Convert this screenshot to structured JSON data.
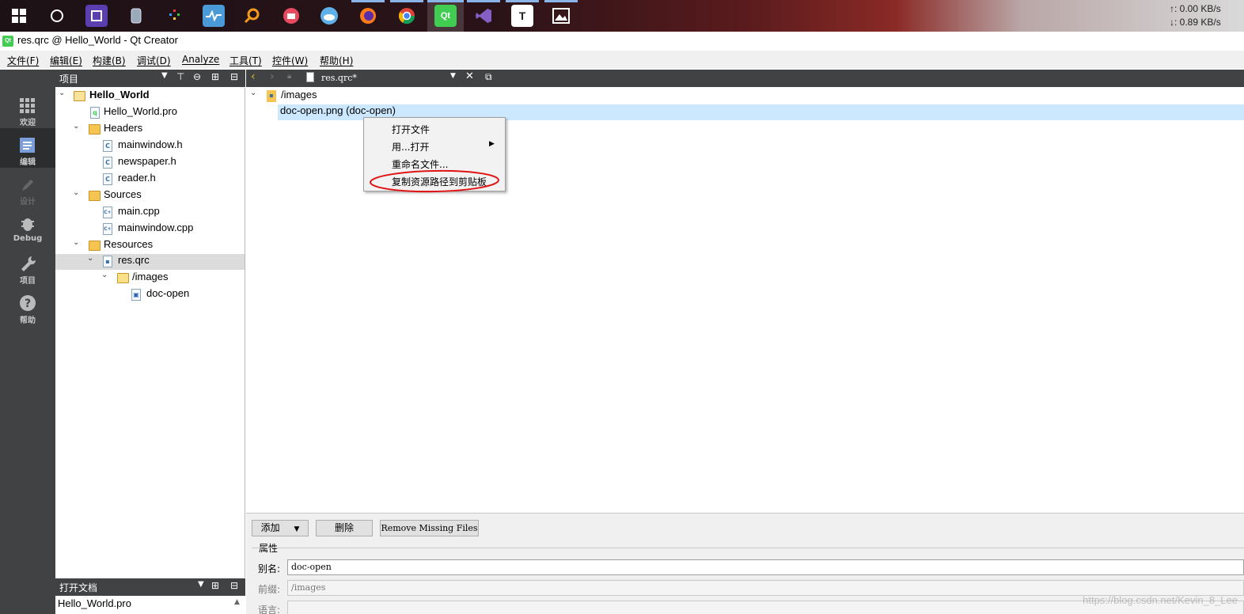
{
  "taskbar": {
    "net_up": "↑: 0.00 KB/s",
    "net_down": "↓: 0.89 KB/s",
    "icons": [
      "windows-icon",
      "cortana-icon",
      "chip-icon",
      "database-icon",
      "grid-icon",
      "monitor-icon",
      "search-icon",
      "camera-icon",
      "cloud-icon",
      "firefox-icon",
      "chrome-icon",
      "qt-icon",
      "visual-studio-icon",
      "typora-icon",
      "photos-icon"
    ]
  },
  "window": {
    "title": "res.qrc @ Hello_World - Qt Creator"
  },
  "menu": [
    "文件(F)",
    "编辑(E)",
    "构建(B)",
    "调试(D)",
    "Analyze",
    "工具(T)",
    "控件(W)",
    "帮助(H)"
  ],
  "modes": [
    {
      "label": "欢迎",
      "icon": "grid-icon"
    },
    {
      "label": "编辑",
      "icon": "edit-icon"
    },
    {
      "label": "设计",
      "icon": "pencil-icon"
    },
    {
      "label": "Debug",
      "icon": "bug-icon"
    },
    {
      "label": "项目",
      "icon": "wrench-icon"
    },
    {
      "label": "帮助",
      "icon": "help-icon"
    }
  ],
  "project_panel": {
    "title": "项目"
  },
  "tree": {
    "root": "Hello_World",
    "pro": "Hello_World.pro",
    "headers": "Headers",
    "h1": "mainwindow.h",
    "h2": "newspaper.h",
    "h3": "reader.h",
    "sources": "Sources",
    "s1": "main.cpp",
    "s2": "mainwindow.cpp",
    "resources": "Resources",
    "qrc": "res.qrc",
    "images": "/images",
    "doc": "doc-open"
  },
  "open_docs": {
    "title": "打开文档",
    "item": "Hello_World.pro"
  },
  "editor": {
    "tab": "res.qrc*",
    "prefix": "/images",
    "file": "doc-open.png (doc-open)"
  },
  "context_menu": [
    "打开文件",
    "用...打开",
    "重命名文件...",
    "复制资源路径到剪贴板"
  ],
  "bottom": {
    "add": "添加",
    "remove": "删除",
    "remove_missing": "Remove Missing Files",
    "properties": "属性",
    "alias_label": "别名:",
    "alias_value": "doc-open",
    "prefix_label": "前缀:",
    "prefix_value": "/images",
    "lang_label": "语言:"
  },
  "watermark": "https://blog.csdn.net/Kevin_8_Lee"
}
